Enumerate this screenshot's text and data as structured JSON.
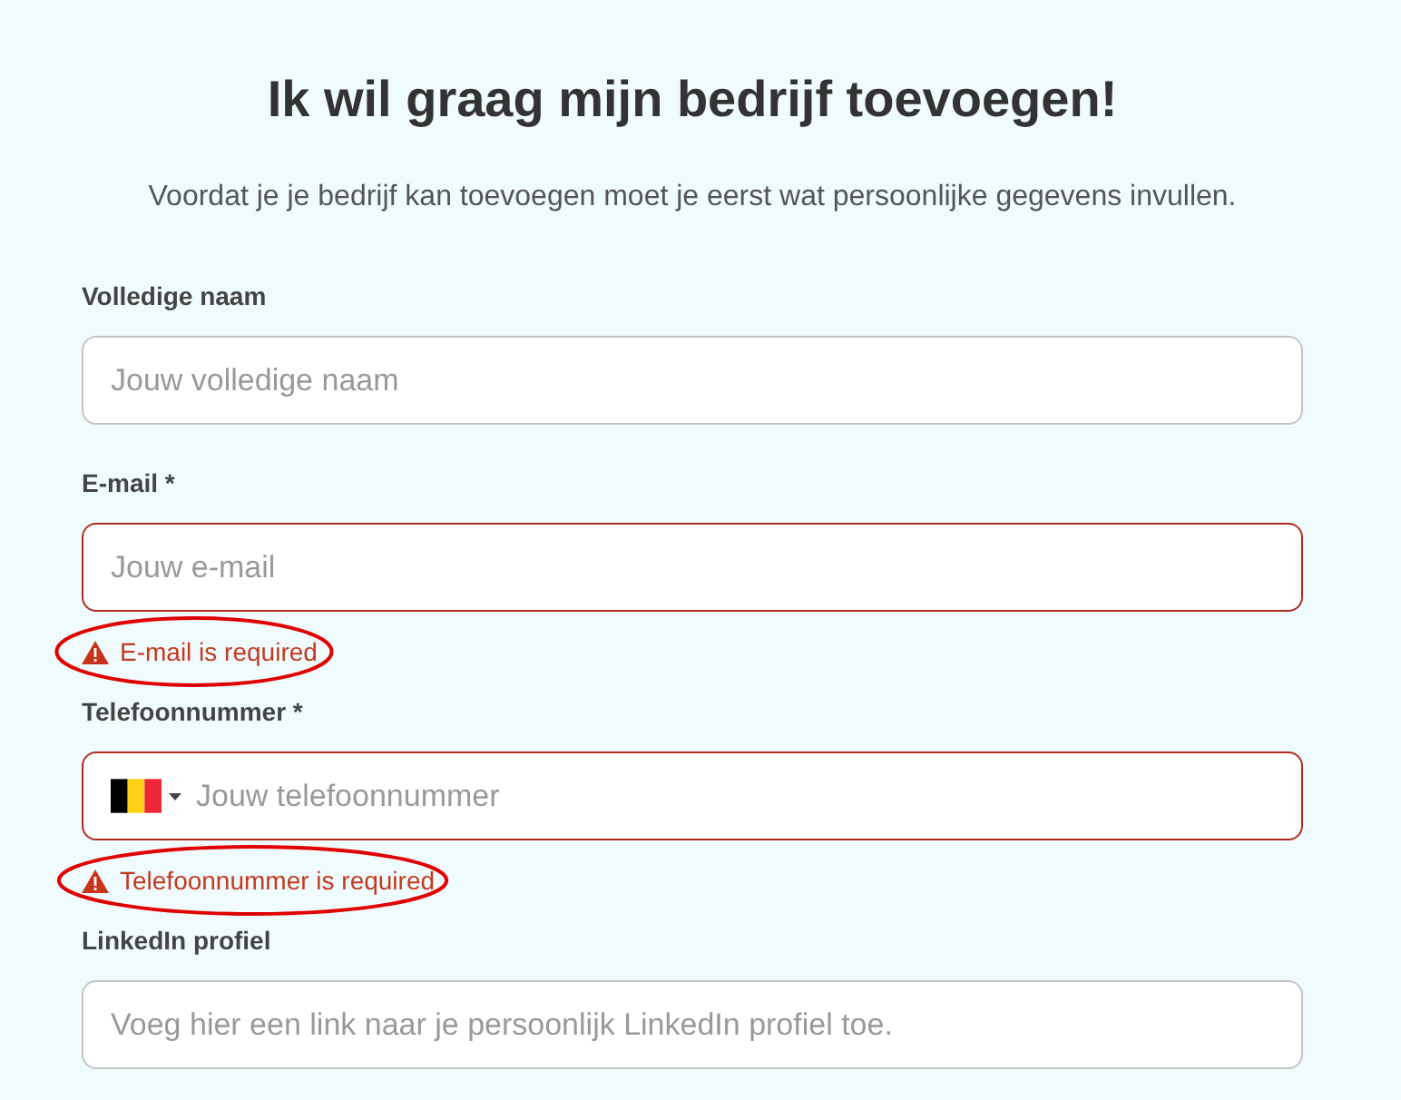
{
  "title": "Ik wil graag mijn bedrijf toevoegen!",
  "subtitle": "Voordat je je bedrijf kan toevoegen moet je eerst wat persoonlijke gegevens invullen.",
  "fields": [
    {
      "kind": "text",
      "label": "Volledige naam",
      "placeholder": "Jouw volledige naam",
      "invalid": false
    },
    {
      "kind": "text",
      "label": "E-mail *",
      "placeholder": "Jouw e-mail",
      "invalid": true,
      "error": "E-mail is required",
      "circled": true
    },
    {
      "kind": "phone",
      "label": "Telefoonnummer *",
      "placeholder": "Jouw telefoonnummer",
      "invalid": true,
      "error": "Telefoonnummer is required",
      "circled": true
    },
    {
      "kind": "text",
      "label": "LinkedIn profiel",
      "placeholder": "Voeg hier een link naar je persoonlijk LinkedIn profiel toe.",
      "invalid": false
    }
  ]
}
